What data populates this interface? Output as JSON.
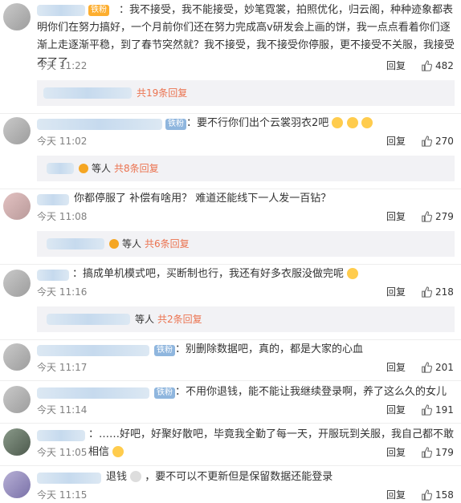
{
  "comments": [
    {
      "badge": "铁粉",
      "text": "：我不接受，我不能接受，妙笔霓裳，拍照优化，归云阁，种种迹象都表明你们在努力搞好，一个月前你们还在努力完成高v研发会上画的饼，我一点点看着你们逐渐上走逐渐平稳，到了春节突然就？我不接受，我不接受你停服，更不接受不关服，我接受不了了",
      "time": "今天 11:22",
      "reply": "回复",
      "likes": "482",
      "thread": {
        "prefix": "",
        "more": "共19条回复"
      }
    },
    {
      "badge": "铁粉",
      "text": "：要不行你们出个云裳羽衣2吧",
      "time": "今天 11:02",
      "reply": "回复",
      "likes": "270",
      "thread": {
        "prefix": "等人",
        "more": "共8条回复"
      }
    },
    {
      "badge": "",
      "text": "你都停服了 补偿有啥用？ 难道还能线下一人发一百钻？",
      "time": "今天 11:08",
      "reply": "回复",
      "likes": "279",
      "thread": {
        "prefix": "等人",
        "more": "共6条回复"
      }
    },
    {
      "badge": "",
      "text": "：搞成单机模式吧，买断制也行，我还有好多衣服没做完呢",
      "time": "今天 11:16",
      "reply": "回复",
      "likes": "218",
      "thread": {
        "prefix": "等人",
        "more": "共2条回复"
      }
    },
    {
      "badge": "铁粉",
      "text": "：别删除数据吧，真的，都是大家的心血",
      "time": "今天 11:17",
      "reply": "回复",
      "likes": "201"
    },
    {
      "badge": "铁粉",
      "text": "：不用你退钱，能不能让我继续登录啊，养了这么久的女儿",
      "time": "今天 11:14",
      "reply": "回复",
      "likes": "191"
    },
    {
      "badge": "",
      "text": "：……好吧，好聚好散吧，毕竟我全勤了每一天，开服玩到关服，我自己都不敢相信",
      "time": "今天 11:05",
      "reply": "回复",
      "likes": "179"
    },
    {
      "badge": "",
      "text": "退钱",
      "text2": "，要不可以不更新但是保留数据还能登录",
      "time": "今天 11:15",
      "reply": "回复",
      "likes": "158"
    }
  ],
  "colors": {
    "link": "#eb7350",
    "muted": "#808080",
    "reply_bg": "#f2f2f5"
  }
}
